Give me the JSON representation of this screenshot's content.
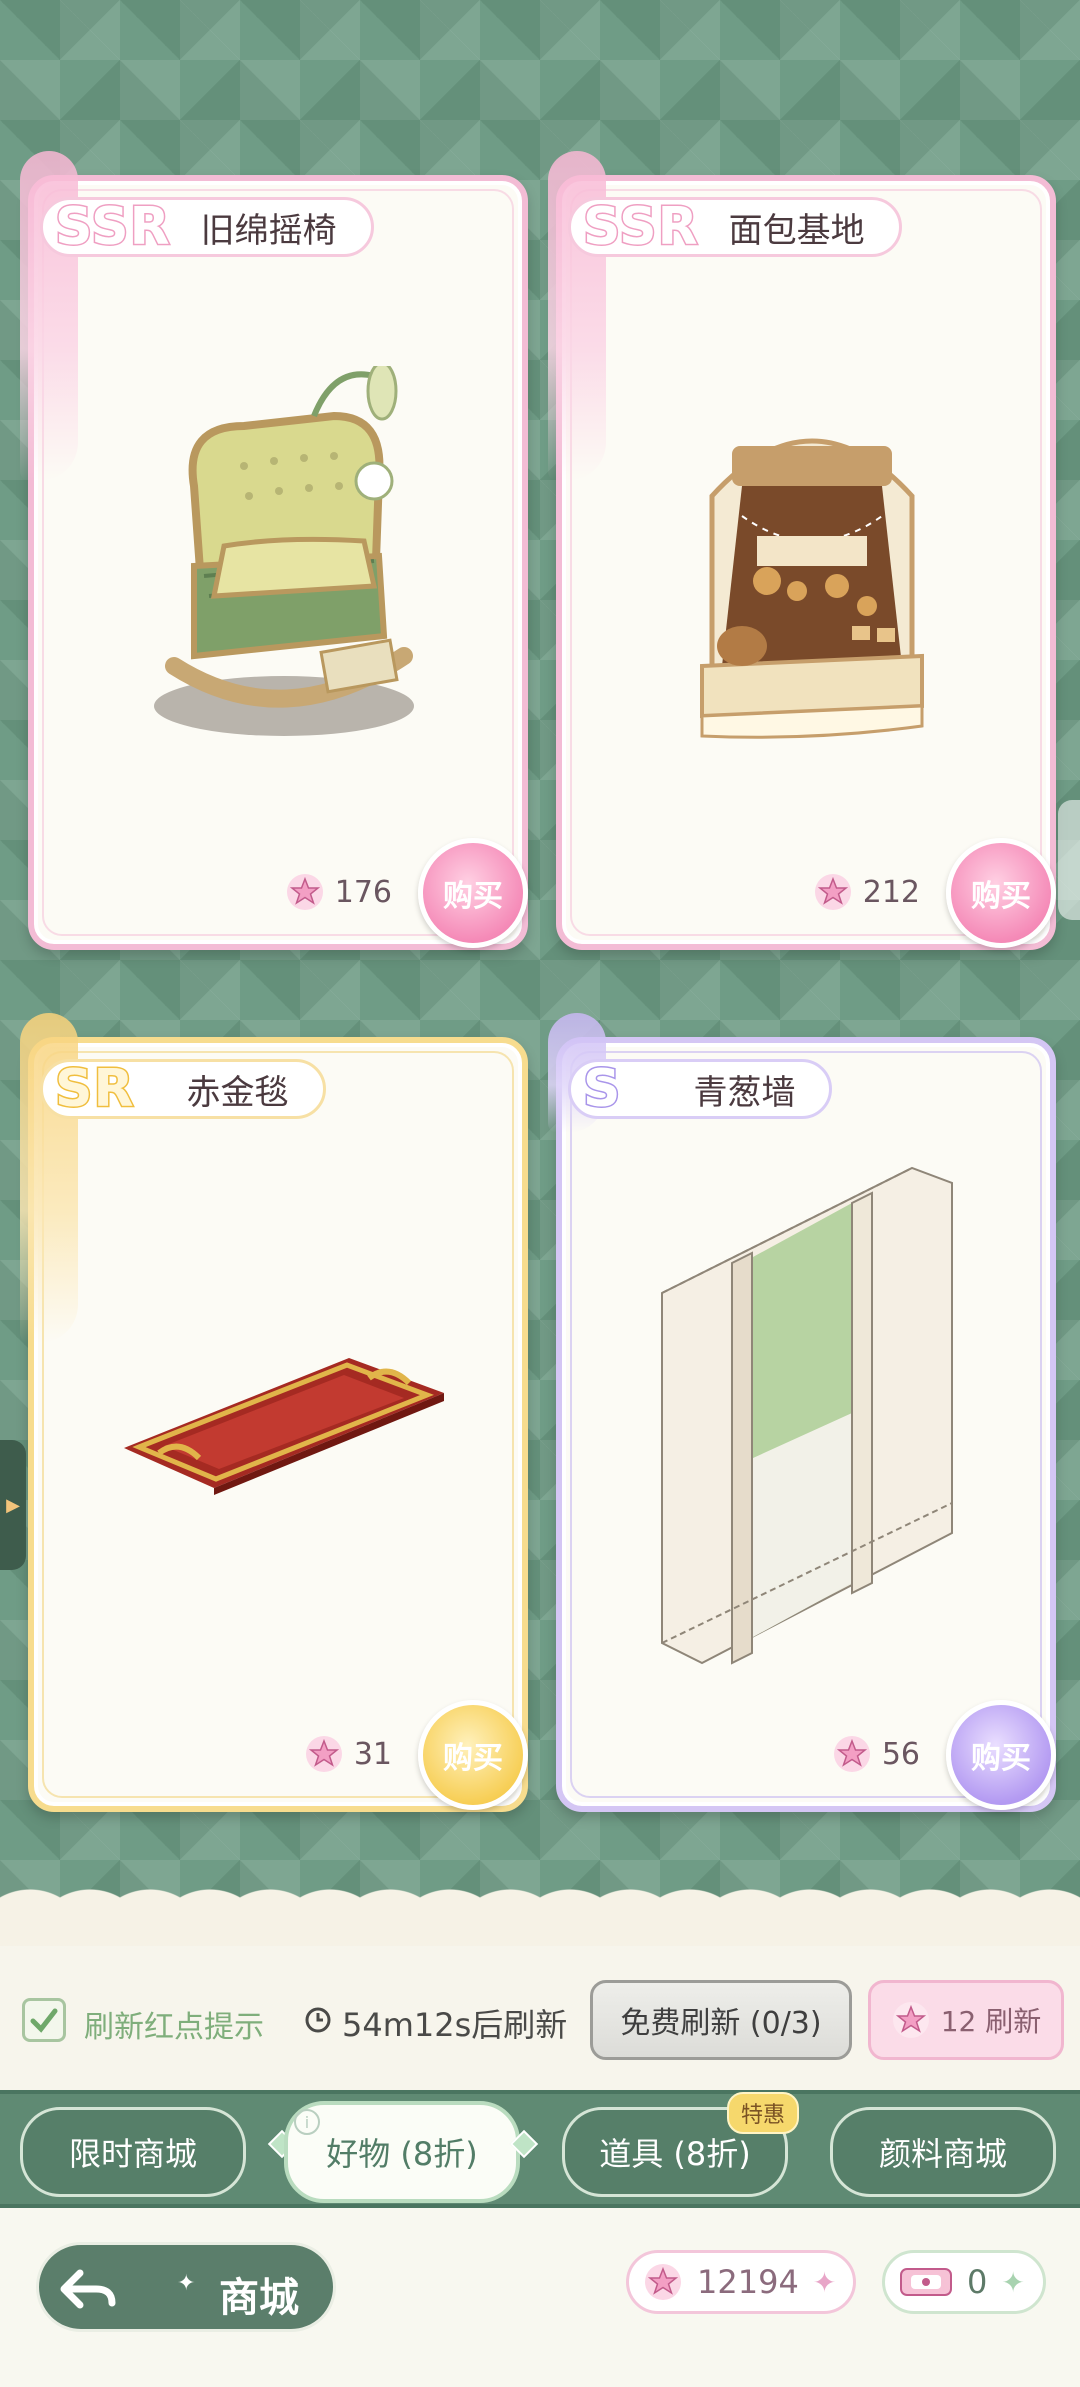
{
  "cards": [
    {
      "rarity": "SSR",
      "name": "旧绵摇椅",
      "price": "176",
      "buy_label": "购买"
    },
    {
      "rarity": "SSR",
      "name": "面包基地",
      "price": "212",
      "buy_label": "购买"
    },
    {
      "rarity": "SR",
      "name": "赤金毯",
      "price": "31",
      "buy_label": "购买"
    },
    {
      "rarity": "S",
      "name": "青葱墙",
      "price": "56",
      "buy_label": "购买"
    }
  ],
  "refresh": {
    "hint_label": "刷新红点提示",
    "timer": "54m12s后刷新",
    "free_label": "免费刷新 (0/3)",
    "paid_label": "12 刷新"
  },
  "tabs": [
    {
      "label": "限时商城"
    },
    {
      "label": "好物 (8折)"
    },
    {
      "label": "道具 (8折)",
      "badge": "特惠"
    },
    {
      "label": "颜料商城"
    }
  ],
  "info_glyph": "i",
  "footer": {
    "title": "商城",
    "star_currency": "12194",
    "ticket_currency": "0"
  },
  "colors": {
    "background": "#6f9c86",
    "ssr": "#f3bcd5",
    "sr": "#f7dc8e",
    "s": "#d4c6f4",
    "tab_active": "#fbfdf7"
  },
  "icons": [
    "star-icon",
    "clock-icon",
    "check-icon",
    "back-arrow-icon",
    "plus-icon",
    "ticket-icon",
    "info-icon"
  ]
}
